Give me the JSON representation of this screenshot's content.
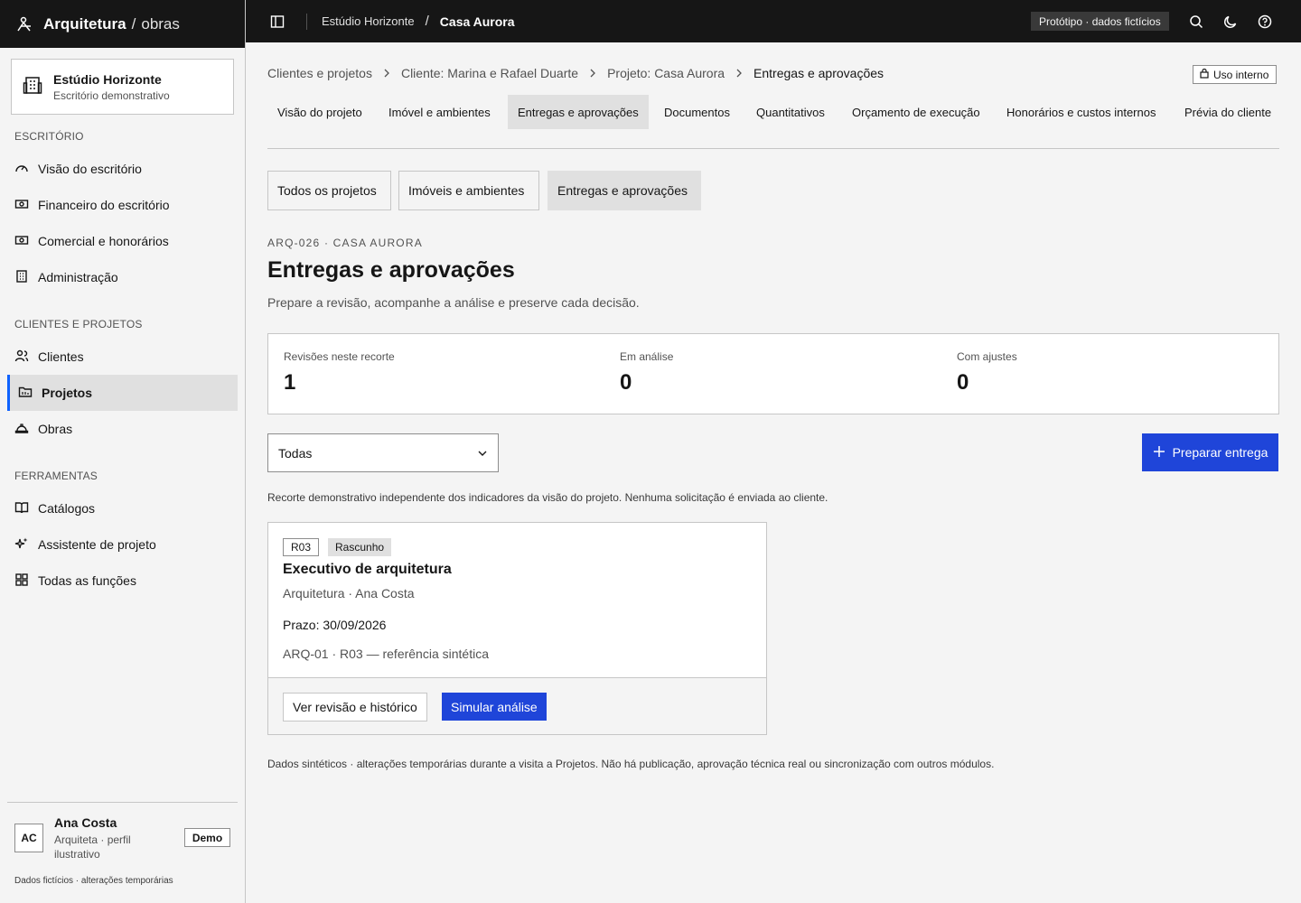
{
  "app": {
    "name": "Arquitetura",
    "separator": "/",
    "module": "obras"
  },
  "topbar": {
    "crumb_org": "Estúdio Horizonte",
    "crumb_sep": "/",
    "crumb_project": "Casa Aurora",
    "prototype_badge": "Protótipo · dados fictícios"
  },
  "org": {
    "name": "Estúdio Horizonte",
    "subtitle": "Escritório demonstrativo"
  },
  "sidebar": {
    "sections": [
      {
        "label": "ESCRITÓRIO"
      },
      {
        "label": "CLIENTES E PROJETOS"
      },
      {
        "label": "FERRAMENTAS"
      }
    ],
    "items": [
      {
        "label": "Visão do escritório",
        "icon": "gauge-icon"
      },
      {
        "label": "Financeiro do escritório",
        "icon": "money-icon"
      },
      {
        "label": "Comercial e honorários",
        "icon": "money-icon"
      },
      {
        "label": "Administração",
        "icon": "building-icon"
      },
      {
        "label": "Clientes",
        "icon": "users-icon"
      },
      {
        "label": "Projetos",
        "icon": "folder-icon",
        "active": true
      },
      {
        "label": "Obras",
        "icon": "helmet-icon"
      },
      {
        "label": "Catálogos",
        "icon": "book-icon"
      },
      {
        "label": "Assistente de projeto",
        "icon": "sparkle-icon"
      },
      {
        "label": "Todas as funções",
        "icon": "grid-icon"
      }
    ]
  },
  "user": {
    "initials": "AC",
    "name": "Ana Costa",
    "role": "Arquiteta · perfil ilustrativo",
    "badge": "Demo",
    "footnote": "Dados fictícios · alterações temporárias"
  },
  "breadcrumb": {
    "items": [
      "Clientes e projetos",
      "Cliente: Marina e Rafael Duarte",
      "Projeto: Casa Aurora",
      "Entregas e aprovações"
    ],
    "internal_badge": "Uso interno"
  },
  "tabs": [
    {
      "label": "Visão do projeto"
    },
    {
      "label": "Imóvel e ambientes"
    },
    {
      "label": "Entregas e aprovações",
      "active": true
    },
    {
      "label": "Documentos"
    },
    {
      "label": "Quantitativos"
    },
    {
      "label": "Orçamento de execução"
    },
    {
      "label": "Honorários e custos internos"
    },
    {
      "label": "Prévia do cliente"
    }
  ],
  "subtabs": [
    {
      "label": "Todos os projetos"
    },
    {
      "label": "Imóveis e ambientes"
    },
    {
      "label": "Entregas e aprovações",
      "active": true
    }
  ],
  "page": {
    "eyebrow": "ARQ-026 · CASA AURORA",
    "title": "Entregas e aprovações",
    "description": "Prepare a revisão, acompanhe a análise e preserve cada decisão."
  },
  "stats": [
    {
      "label": "Revisões neste recorte",
      "value": "1"
    },
    {
      "label": "Em análise",
      "value": "0"
    },
    {
      "label": "Com ajustes",
      "value": "0"
    }
  ],
  "filter": {
    "selected": "Todas"
  },
  "actions": {
    "prepare_label": "Preparar entrega"
  },
  "note": "Recorte demonstrativo independente dos indicadores da visão do projeto. Nenhuma solicitação é enviada ao cliente.",
  "delivery_card": {
    "revision": "R03",
    "status": "Rascunho",
    "title": "Executivo de arquitetura",
    "subtitle": "Arquitetura · Ana Costa",
    "due": "Prazo: 30/09/2026",
    "reference": "ARQ-01 · R03 — referência sintética",
    "view_label": "Ver revisão e histórico",
    "simulate_label": "Simular análise"
  },
  "footer_note": "Dados sintéticos · alterações temporárias durante a visita a Projetos. Não há publicação, aprovação técnica real ou sincronização com outros módulos.",
  "colors": {
    "accent": "#1f45d9",
    "topbar": "#161616",
    "surface": "#f4f4f4"
  }
}
